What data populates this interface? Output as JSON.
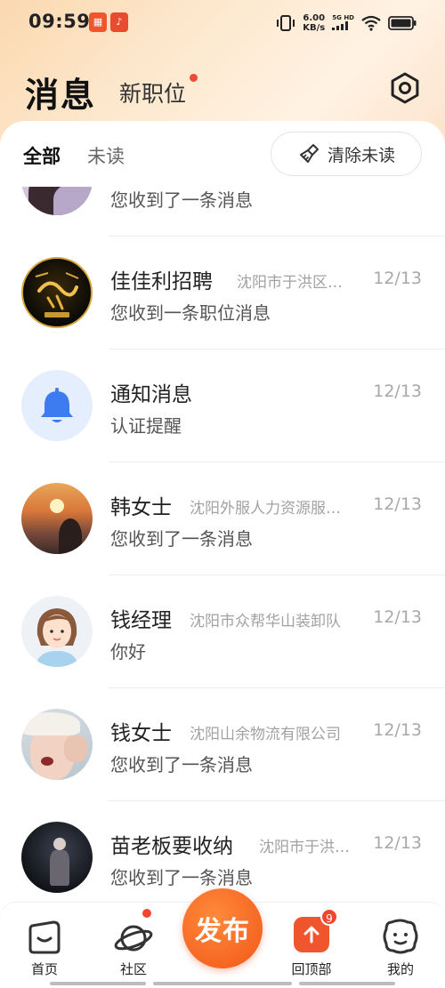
{
  "status_bar": {
    "time": "09:59",
    "speed_value": "6.00",
    "speed_unit": "KB/s",
    "net_top": "5G HD",
    "net_bottom": "HD"
  },
  "header": {
    "title": "消息",
    "new_jobs_label": "新职位"
  },
  "tabs": {
    "all": "全部",
    "unread": "未读",
    "clear_unread": "清除未读"
  },
  "messages": [
    {
      "name": "",
      "company": "",
      "date": "",
      "preview": "您收到了一条消息",
      "avatar": "photo-purple"
    },
    {
      "name": "佳佳利招聘",
      "company": "沈阳市于洪区…",
      "date": "12/13",
      "preview": "您收到一条职位消息",
      "avatar": "calligraphy-logo"
    },
    {
      "name": "通知消息",
      "company": "",
      "date": "12/13",
      "preview": "认证提醒",
      "avatar": "bell-icon"
    },
    {
      "name": "韩女士",
      "company": "沈阳外服人力资源服…",
      "date": "12/13",
      "preview": "您收到了一条消息",
      "avatar": "sunset-photo"
    },
    {
      "name": "钱经理",
      "company": "沈阳市众帮华山装卸队",
      "date": "12/13",
      "preview": "你好",
      "avatar": "cartoon-woman"
    },
    {
      "name": "钱女士",
      "company": "沈阳山余物流有限公司",
      "date": "12/13",
      "preview": "您收到了一条消息",
      "avatar": "selfie-photo"
    },
    {
      "name": "苗老板要收纳",
      "company": "沈阳市于洪…",
      "date": "12/13",
      "preview": "您收到了一条消息",
      "avatar": "dark-photo"
    }
  ],
  "tabbar": {
    "home": "首页",
    "community": "社区",
    "publish": "发布",
    "back_top": "回顶部",
    "back_top_badge": "9",
    "mine": "我的"
  },
  "colors": {
    "accent": "#f2571a",
    "badge": "#f0472e",
    "bell": "#3d7bf0"
  }
}
